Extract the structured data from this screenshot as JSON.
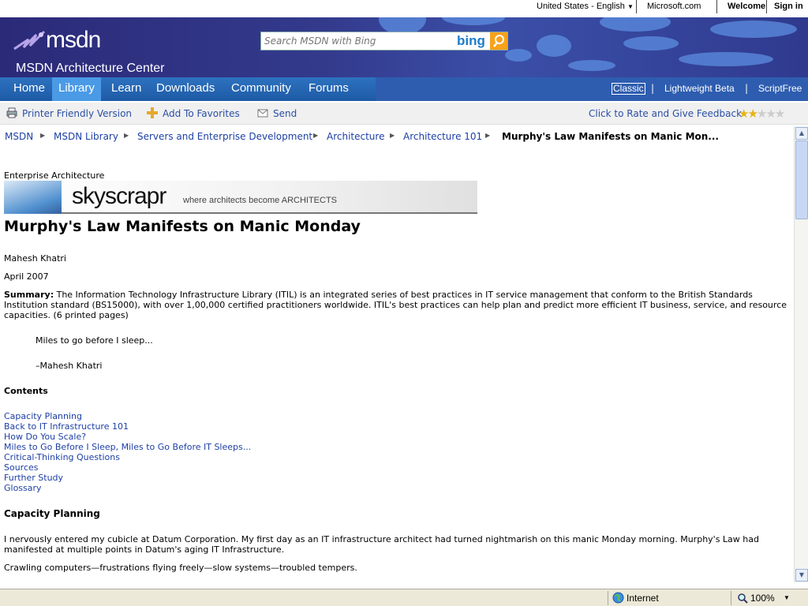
{
  "util_bar": {
    "locale": "United States - English",
    "site": "Microsoft.com",
    "welcome": "Welcome",
    "sign_in": "Sign in"
  },
  "header": {
    "logo": "msdn",
    "section_title": "MSDN Architecture Center",
    "search_placeholder": "Search MSDN with Bing",
    "search_brand": "bing"
  },
  "nav": {
    "tabs": [
      "Home",
      "Library",
      "Learn",
      "Downloads",
      "Community",
      "Forums"
    ],
    "active_tab": "Library",
    "views": [
      "Classic",
      "Lightweight Beta",
      "ScriptFree"
    ],
    "separator": "|"
  },
  "toolbar": {
    "printer": "Printer Friendly Version",
    "favorites": "Add To Favorites",
    "send": "Send",
    "feedback": "Click to Rate and Give Feedback",
    "rating_stars": 2,
    "rating_max": 5
  },
  "breadcrumb": {
    "items": [
      "MSDN",
      "MSDN Library",
      "Servers and Enterprise Development",
      "Architecture",
      "Architecture 101"
    ],
    "current": "Murphy's Law Manifests on Manic Mon..."
  },
  "article": {
    "category": "Enterprise Architecture",
    "banner_brand": "skyscrapr",
    "banner_tagline": "where architects become ARCHITECTS",
    "title": "Murphy's Law Manifests on Manic Monday",
    "author": "Mahesh Khatri",
    "date": "April 2007",
    "summary_label": "Summary:",
    "summary_text": " The Information Technology Infrastructure Library (ITIL) is an integrated series of best practices in IT service management that conform to the British Standards Institution standard (BS15000), with over 1,00,000 certified practitioners worldwide. ITIL's best practices can help plan and predict more efficient IT business, service, and resource capacities. (6 printed pages)",
    "quote": "Miles to go before I sleep...",
    "quote_author": "–Mahesh Khatri",
    "contents_heading": "Contents",
    "contents": [
      "Capacity Planning",
      "Back to IT Infrastructure 101",
      "How Do You Scale?",
      "Miles to Go Before I Sleep, Miles to Go Before IT Sleeps...",
      "Critical-Thinking Questions",
      "Sources",
      "Further Study",
      "Glossary"
    ],
    "section_heading": "Capacity Planning",
    "para1": "I nervously entered my cubicle at Datum Corporation. My first day as an IT infrastructure architect had turned nightmarish on this manic Monday morning. Murphy's Law had manifested at multiple points in Datum's aging IT Infrastructure.",
    "para2": "Crawling computers—frustrations flying freely—slow systems—troubled tempers."
  },
  "status_bar": {
    "zone": "Internet",
    "zoom": "100%"
  },
  "colors": {
    "header_bg": "#2b2a78",
    "nav_bg": "#2e5db0",
    "nav_active": "#4b9ae6",
    "link": "#1d3fa4",
    "bing_orange": "#f7a21b"
  }
}
